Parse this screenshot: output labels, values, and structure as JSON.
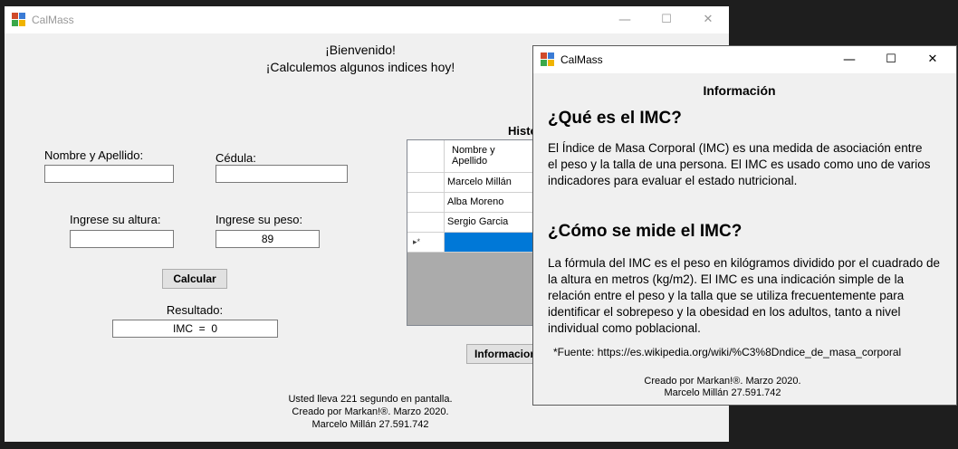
{
  "main_window": {
    "title": "CalMass",
    "welcome": "¡Bienvenido!",
    "subtitle": "¡Calculemos algunos indices hoy!",
    "name_label": "Nombre y Apellido:",
    "name_value": "",
    "id_label": "Cédula:",
    "id_value": "",
    "height_label": "Ingrese su altura:",
    "height_value": "",
    "weight_label": "Ingrese su peso:",
    "weight_value": "89",
    "calc_button": "Calcular",
    "result_label": "Resultado:",
    "result_value": "IMC  =  0",
    "history_label": "Histo",
    "history_header": [
      "Nombre y",
      "Apellido"
    ],
    "history_rows": [
      "Marcelo Millán",
      "Alba Moreno",
      "Sergio Garcia"
    ],
    "new_row_marker": "▸*",
    "info_button": "Informacion",
    "footer": [
      "Usted lleva 221 segundo en pantalla.",
      "Creado por Markan!®. Marzo 2020.",
      "Marcelo Millán 27.591.742"
    ]
  },
  "info_window": {
    "title": "CalMass",
    "heading": "Información",
    "q1": "¿Qué es el IMC?",
    "p1": "El Índice de Masa Corporal (IMC) es una medida de asociación entre el peso y la talla de una persona. El IMC es usado como uno de varios indicadores para evaluar el estado nutricional.",
    "q2": "¿Cómo se mide el IMC?",
    "p2": "La fórmula del IMC es el peso en kilógramos dividido por el cuadrado de la altura en metros (kg/m2). El IMC es una indicación simple de la relación entre el peso y la talla que se utiliza frecuentemente para identificar el sobrepeso y la obesidad en los adultos, tanto a nivel individual como poblacional.",
    "source": "*Fuente: https://es.wikipedia.org/wiki/%C3%8Dndice_de_masa_corporal",
    "credit": [
      "Creado por Markan!®. Marzo 2020.",
      "Marcelo Millán 27.591.742"
    ]
  },
  "icons": {
    "minimize": "minimize-icon",
    "maximize": "maximize-icon",
    "close": "close-icon",
    "app": "app-icon"
  },
  "colors": {
    "selection": "#0078d7",
    "window_bg": "#f0f0f0",
    "desktop_bg": "#1e1e1e"
  }
}
